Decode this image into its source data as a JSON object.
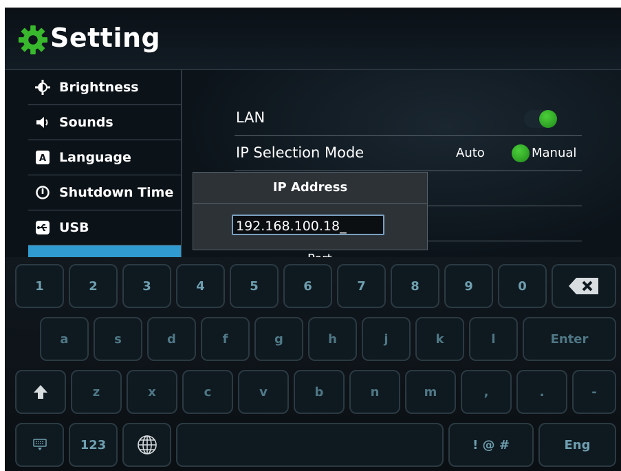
{
  "header": {
    "title": "Setting",
    "icon": "gear-icon",
    "accent": "#39b82e"
  },
  "sidebar": {
    "items": [
      {
        "label": "Brightness",
        "icon": "brightness-icon"
      },
      {
        "label": "Sounds",
        "icon": "speaker-icon"
      },
      {
        "label": "Language",
        "icon": "language-icon"
      },
      {
        "label": "Shutdown Time",
        "icon": "power-icon"
      },
      {
        "label": "USB",
        "icon": "usb-icon"
      },
      {
        "label": "",
        "icon": "network-icon"
      }
    ],
    "active_color": "#2f9bd0"
  },
  "settings": {
    "lan_label": "LAN",
    "ip_mode_label": "IP Selection Mode",
    "ip_mode_options": [
      "Auto",
      "Manual"
    ],
    "ip_mode_selected": "Manual",
    "partial_text": "Port"
  },
  "dialog": {
    "title": "IP Address",
    "ip_value": "192.168.100.18_"
  },
  "keyboard": {
    "row1": [
      "1",
      "2",
      "3",
      "4",
      "5",
      "6",
      "7",
      "8",
      "9",
      "0"
    ],
    "backspace_icon": "backspace-icon",
    "row2": [
      "a",
      "s",
      "d",
      "f",
      "g",
      "h",
      "j",
      "k",
      "l"
    ],
    "enter_label": "Enter",
    "shift_icon": "shift-icon",
    "row3": [
      "z",
      "x",
      "c",
      "v",
      "b",
      "n",
      "m",
      ",",
      ".",
      "-"
    ],
    "keyboard_icon": "keyboard-hide-icon",
    "num_label": "123",
    "globe_icon": "globe-icon",
    "symbols_label": "! @ #",
    "lang_label": "Eng"
  }
}
